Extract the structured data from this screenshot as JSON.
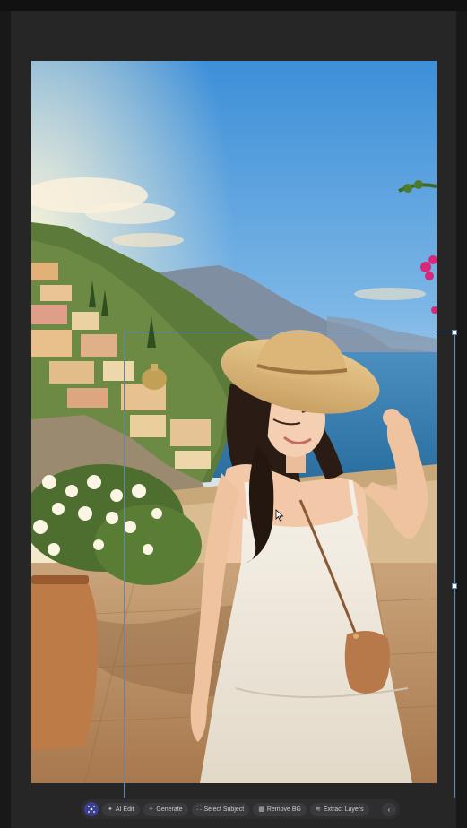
{
  "toolbar": {
    "buttons": [
      {
        "label": "AI Edit",
        "icon": "sparkle-icon"
      },
      {
        "label": "Generate",
        "icon": "wand-icon"
      },
      {
        "label": "Select Subject",
        "icon": "select-subject-icon"
      },
      {
        "label": "Remove BG",
        "icon": "remove-bg-icon"
      },
      {
        "label": "Extract Layers",
        "icon": "layers-icon"
      }
    ],
    "collapse_glyph": "‹"
  },
  "colors": {
    "background": "#1e1e1e",
    "panel": "#262626",
    "toolbar": "#2e2e30",
    "selection": "#5b86b5",
    "logo": "#3a3f8f"
  }
}
